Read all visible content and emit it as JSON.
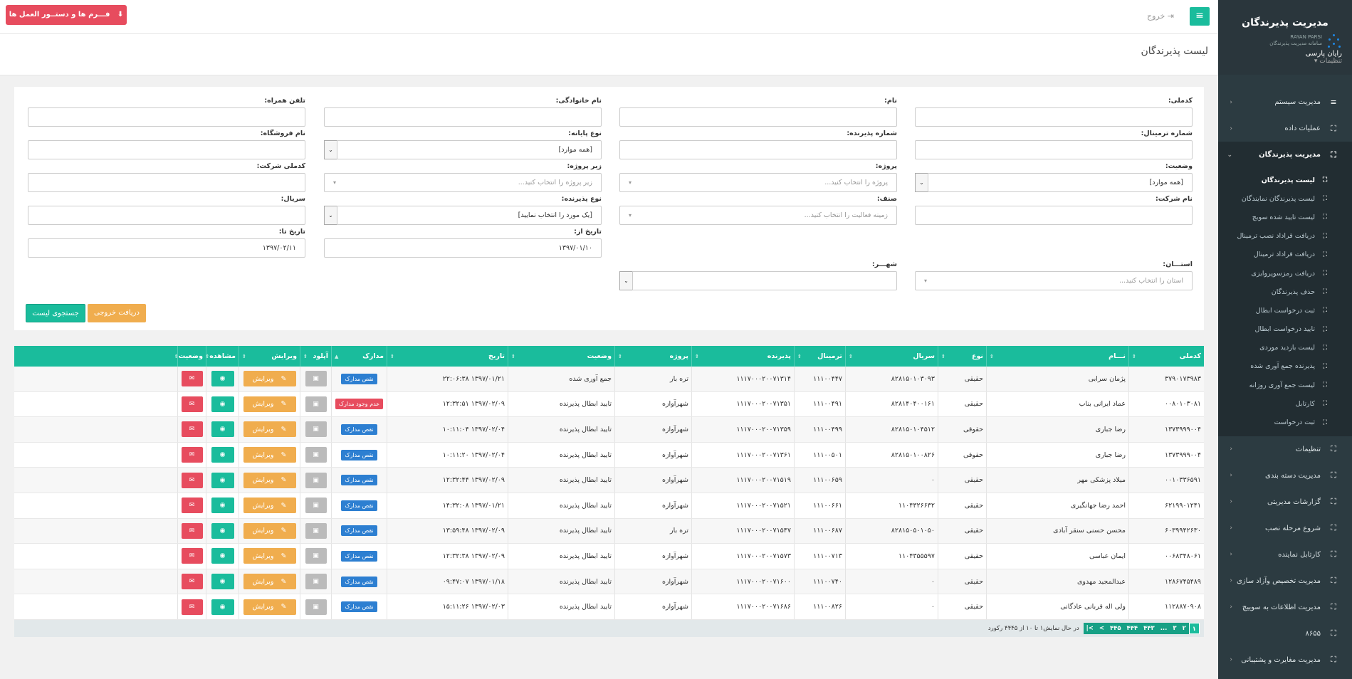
{
  "sidebar": {
    "title": "مدیریت پذیرندگان",
    "logo_text": "RAYAN PARSI",
    "logo_sub": "سامانه مدیریت پذیرندگان",
    "user": "رایان پارسی",
    "settings": "تنظیمات",
    "items_top": [
      {
        "label": "مدیریت سیستم"
      },
      {
        "label": "عملیات داده"
      },
      {
        "label": "مدیریت پذیرندگان"
      }
    ],
    "sub_items": [
      {
        "label": "لیست پذیرندگان"
      },
      {
        "label": "لیست پذیرندگان نمایندگان"
      },
      {
        "label": "لیست تایید شده سویچ"
      },
      {
        "label": "دریافت قراداد نصب ترمینال"
      },
      {
        "label": "دریافت قراداد ترمینال"
      },
      {
        "label": "دریافت رمزسوپروایزی"
      },
      {
        "label": "حذف پذیرندگان"
      },
      {
        "label": "ثبت درخواست ابطال"
      },
      {
        "label": "تایید درخواست ابطال"
      },
      {
        "label": "لیست بازدید موردی"
      },
      {
        "label": "پذیرنده جمع آوری شده"
      },
      {
        "label": "لیست جمع آوری روزانه"
      },
      {
        "label": "کارتابل"
      },
      {
        "label": "ثبت درخواست"
      }
    ],
    "items_bottom": [
      {
        "label": "تنظیمات"
      },
      {
        "label": "مدیریت دسته بندی"
      },
      {
        "label": "گزارشات مدیریتی"
      },
      {
        "label": "شروع مرحله نصب"
      },
      {
        "label": "کارتابل نماینده"
      },
      {
        "label": "مدیریت تخصیص وآزاد سازی"
      },
      {
        "label": "مدیریت اظلاعات به سوییچ"
      },
      {
        "label": "۸۶۵۵"
      },
      {
        "label": "مدیریت مغایرت و پشتیبانی"
      }
    ]
  },
  "topbar": {
    "logout": "خروج",
    "forms_button": "فـــرم ها و دستــور العمل ها"
  },
  "page": {
    "title": "لیست پذیرندگان"
  },
  "filters": {
    "national_code": "کدملی:",
    "first_name": "نام:",
    "last_name": "نام خانوادگی:",
    "mobile": "تلفن همراه:",
    "terminal_no": "شماره ترمینال:",
    "acceptor_no": "شماره پذیرنده:",
    "terminal_type": "نوع پایانه:",
    "store_name": "نام فروشگاه:",
    "status": "وضعیت:",
    "project": "پروژه:",
    "sub_project": "زیر پروژه:",
    "company_code": "کدملی شرکت:",
    "company_name": "نام شرکت:",
    "guild": "صنف:",
    "acceptor_type": "نوع پذیرنده:",
    "serial": "سریال:",
    "date_from": "تاریخ از:",
    "date_to": "تاریخ تا:",
    "province": "استـــان:",
    "city": "شهـــر:",
    "all": "[همه موارد]",
    "project_ph": "پروژه را انتخاب کنید...",
    "sub_project_ph": "زیر پروژه را انتخاب کنید...",
    "guild_ph": "زمینه فعالیت را انتخاب کنید...",
    "acceptor_type_val": "[یک مورد را انتخاب نمایید]",
    "province_ph": "استان را انتخاب کنید...",
    "date_from_val": "۱۳۹۷/۰۱/۱۰",
    "date_to_val": "۱۳۹۷/۰۲/۱۱",
    "search_btn": "جستجوی لیست",
    "export_btn": "دریافت خروجی"
  },
  "table": {
    "headers": [
      "کدملی",
      "نـــام",
      "نوع",
      "سریال",
      "ترمینال",
      "پذیرنده",
      "پروژه",
      "وضعیت",
      "تاریخ",
      "مدارک",
      "آپلود",
      "ویرایش",
      "مشاهده",
      "وضعیت"
    ],
    "edit_label": "ویرایش",
    "rows": [
      {
        "code": "۳۷۹۰۱۷۳۹۸۳",
        "name": "پژمان سرابی",
        "type": "حقیقی",
        "serial": "۸۲۸۱۵۰۱۰۳۰۹۳",
        "terminal": "۱۱۱۰۰۴۴۷",
        "acceptor": "۱۱۱۷۰۰۰۲۰۰۷۱۳۱۴",
        "project": "تره بار",
        "status": "جمع آوری شده",
        "date": "۱۳۹۷/۰۱/۲۱ ۲۲:۰۶:۳۸",
        "doc": "نقص مدارک",
        "doc_red": false
      },
      {
        "code": "۰۰۸۰۱۰۳۰۸۱",
        "name": "عماد ایرانی بناب",
        "type": "حقیقی",
        "serial": "۸۲۸۱۴۰۴۰۰۱۶۱",
        "terminal": "۱۱۱۰۰۴۹۱",
        "acceptor": "۱۱۱۷۰۰۰۲۰۰۷۱۳۵۱",
        "project": "شهرآوازه",
        "status": "تایید ابطال پذیرنده",
        "date": "۱۳۹۷/۰۲/۰۹ ۱۲:۳۲:۵۱",
        "doc": "عدم وجود مدارک",
        "doc_red": true
      },
      {
        "code": "۱۳۷۳۹۹۹۰۰۴",
        "name": "رضا جباری",
        "type": "حقوقی",
        "serial": "۸۲۸۱۵۰۱۰۴۵۱۲",
        "terminal": "۱۱۱۰۰۴۹۹",
        "acceptor": "۱۱۱۷۰۰۰۲۰۰۷۱۳۵۹",
        "project": "شهرآوازه",
        "status": "تایید ابطال پذیرنده",
        "date": "۱۳۹۷/۰۲/۰۴ ۱۰:۱۱:۰۴",
        "doc": "نقص مدارک",
        "doc_red": false
      },
      {
        "code": "۱۳۷۳۹۹۹۰۰۴",
        "name": "رضا جباری",
        "type": "حقوقی",
        "serial": "۸۲۸۱۵۰۱۰۰۸۲۶",
        "terminal": "۱۱۱۰۰۵۰۱",
        "acceptor": "۱۱۱۷۰۰۰۲۰۰۷۱۳۶۱",
        "project": "شهرآوازه",
        "status": "تایید ابطال پذیرنده",
        "date": "۱۳۹۷/۰۲/۰۴ ۱۰:۱۱:۲۰",
        "doc": "نقص مدارک",
        "doc_red": false
      },
      {
        "code": "۰۰۱۰۳۳۶۵۹۱",
        "name": "میلاد پزشکی مهر",
        "type": "حقیقی",
        "serial": "۰",
        "terminal": "۱۱۱۰۰۶۵۹",
        "acceptor": "۱۱۱۷۰۰۰۲۰۰۷۱۵۱۹",
        "project": "شهرآوازه",
        "status": "تایید ابطال پذیرنده",
        "date": "۱۳۹۷/۰۲/۰۹ ۱۲:۳۲:۴۴",
        "doc": "نقص مدارک",
        "doc_red": false
      },
      {
        "code": "۶۲۱۹۹۰۱۲۴۱",
        "name": "احمد رضا جهانگیری",
        "type": "حقیقی",
        "serial": "۱۱۰۴۳۲۶۶۳۲",
        "terminal": "۱۱۱۰۰۶۶۱",
        "acceptor": "۱۱۱۷۰۰۰۲۰۰۷۱۵۲۱",
        "project": "شهرآوازه",
        "status": "تایید ابطال پذیرنده",
        "date": "۱۳۹۷/۰۱/۲۱ ۱۴:۳۲:۰۸",
        "doc": "نقص مدارک",
        "doc_red": false
      },
      {
        "code": "۶۰۳۹۹۴۲۶۳۰",
        "name": "محسن حسنی سنقر آبادی",
        "type": "حقیقی",
        "serial": "۸۲۸۱۵۰۵۰۱۰۵۰",
        "terminal": "۱۱۱۰۰۶۸۷",
        "acceptor": "۱۱۱۷۰۰۰۲۰۰۷۱۵۴۷",
        "project": "تره بار",
        "status": "تایید ابطال پذیرنده",
        "date": "۱۳۹۷/۰۲/۰۹ ۱۳:۵۹:۴۸",
        "doc": "نقص مدارک",
        "doc_red": false
      },
      {
        "code": "۰۰۶۸۳۴۸۰۶۱",
        "name": "ایمان عباسی",
        "type": "حقیقی",
        "serial": "۱۱۰۴۳۵۵۵۹۷",
        "terminal": "۱۱۱۰۰۷۱۳",
        "acceptor": "۱۱۱۷۰۰۰۲۰۰۷۱۵۷۳",
        "project": "شهرآوازه",
        "status": "تایید ابطال پذیرنده",
        "date": "۱۳۹۷/۰۲/۰۹ ۱۲:۳۲:۳۸",
        "doc": "نقص مدارک",
        "doc_red": false
      },
      {
        "code": "۱۲۸۶۷۴۵۴۸۹",
        "name": "عبدالمجید مهدوی",
        "type": "حقیقی",
        "serial": "۰",
        "terminal": "۱۱۱۰۰۷۴۰",
        "acceptor": "۱۱۱۷۰۰۰۲۰۰۷۱۶۰۰",
        "project": "شهرآوازه",
        "status": "تایید ابطال پذیرنده",
        "date": "۱۳۹۷/۰۱/۱۸ ۰۹:۴۷:۰۷",
        "doc": "نقص مدارک",
        "doc_red": false
      },
      {
        "code": "۱۱۲۸۸۷۰۹۰۸",
        "name": "ولی اله قربانی عادگانی",
        "type": "حقیقی",
        "serial": "۰",
        "terminal": "۱۱۱۰۰۸۲۶",
        "acceptor": "۱۱۱۷۰۰۰۲۰۰۷۱۶۸۶",
        "project": "شهرآوازه",
        "status": "تایید ابطال پذیرنده",
        "date": "۱۳۹۷/۰۲/۰۳ ۱۵:۱۱:۲۶",
        "doc": "نقص مدارک",
        "doc_red": false
      }
    ]
  },
  "pager": {
    "pages": [
      "۱",
      "۲",
      "۳",
      "...",
      "۴۴۳",
      "۴۴۴",
      "۴۴۵"
    ],
    "next": ">",
    "last": ">|",
    "info": "در حال نمایش۱ تا ۱۰ از ۴۴۴۵ رکورد"
  },
  "colors": {
    "accent": "#1abc9c",
    "danger": "#e74c5e",
    "warning": "#f0ad4e",
    "sidebar": "#2c3b41"
  }
}
